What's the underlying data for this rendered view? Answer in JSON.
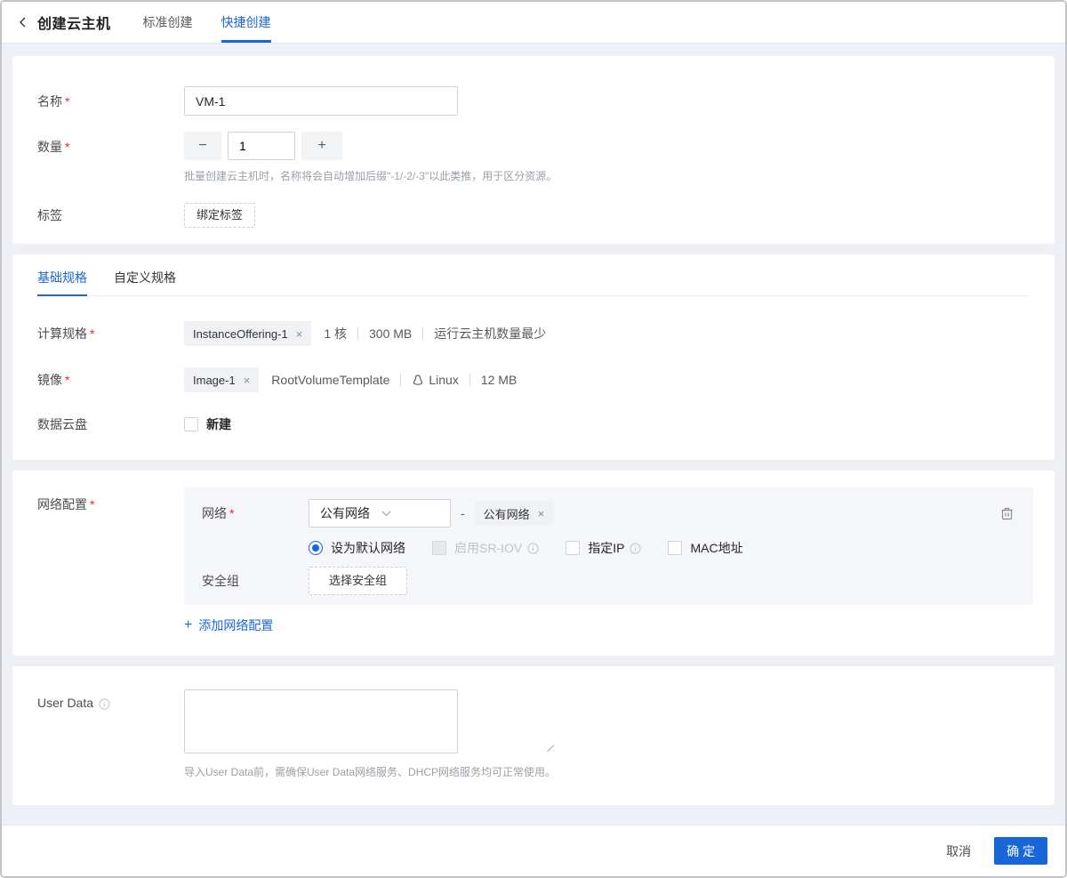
{
  "colors": {
    "accent": "#1966d8",
    "required": "#f5222d",
    "panel_bg": "#f5f6f9",
    "page_bg": "#eef0f5"
  },
  "header": {
    "title": "创建云主机",
    "tabs": [
      {
        "label": "标准创建"
      },
      {
        "label": "快捷创建"
      }
    ]
  },
  "basic": {
    "name": {
      "label": "名称",
      "value": "VM-1"
    },
    "count": {
      "label": "数量",
      "value": "1",
      "minus": "−",
      "plus": "+",
      "hint": "批量创建云主机时，名称将会自动增加后缀\"-1/-2/-3\"以此类推，用于区分资源。"
    },
    "tag": {
      "label": "标签",
      "button": "绑定标签"
    }
  },
  "spec": {
    "tabs": [
      {
        "label": "基础规格"
      },
      {
        "label": "自定义规格"
      }
    ],
    "offering": {
      "label": "计算规格",
      "tag": "InstanceOffering-1",
      "remove": "×",
      "meta": [
        "1 核",
        "300 MB",
        "运行云主机数量最少"
      ]
    },
    "image": {
      "label": "镜像",
      "tag": "Image-1",
      "remove": "×",
      "type": "RootVolumeTemplate",
      "os": "Linux",
      "size": "12 MB"
    },
    "data_volume": {
      "label": "数据云盘",
      "checkbox": "新建"
    }
  },
  "network": {
    "label": "网络配置",
    "net_label": "网络",
    "select_value": "公有网络",
    "dash": "-",
    "tag": "公有网络",
    "tag_remove": "×",
    "options": [
      {
        "label": "设为默认网络"
      },
      {
        "label": "启用SR-IOV"
      },
      {
        "label": "指定IP"
      },
      {
        "label": "MAC地址"
      }
    ],
    "sg_label": "安全组",
    "sg_button": "选择安全组",
    "add_plus": "+",
    "add_link": "添加网络配置"
  },
  "userdata": {
    "label": "User Data",
    "hint": "导入User Data前，需确保User Data网络服务、DHCP网络服务均可正常使用。"
  },
  "footer": {
    "cancel": "取消",
    "ok": "确 定"
  }
}
